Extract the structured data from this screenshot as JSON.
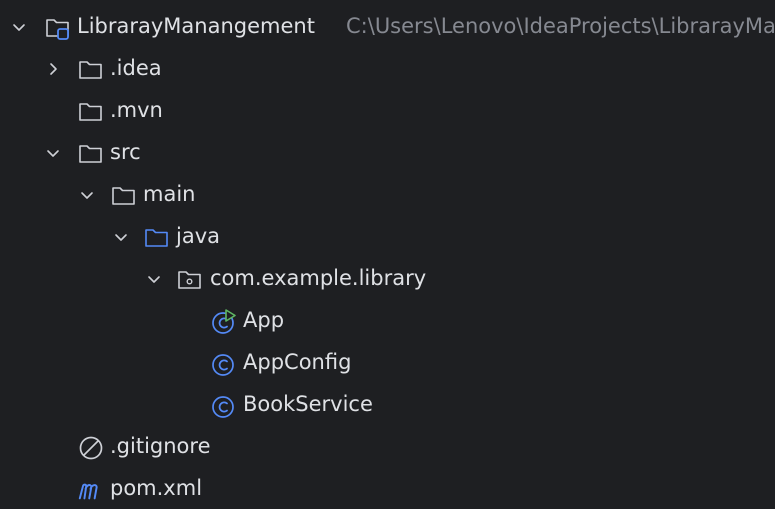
{
  "project": {
    "name": "LibrarayManangement",
    "path": "C:\\Users\\Lenovo\\IdeaProjects\\LibrarayManangement",
    "expanded": true,
    "icon": "project-folder-icon"
  },
  "tree": {
    "idea": {
      "label": ".idea",
      "expanded": false,
      "icon": "folder-icon"
    },
    "mvn": {
      "label": ".mvn",
      "icon": "folder-icon"
    },
    "src": {
      "label": "src",
      "expanded": true,
      "icon": "folder-icon"
    },
    "main": {
      "label": "main",
      "expanded": true,
      "icon": "folder-icon"
    },
    "java": {
      "label": "java",
      "expanded": true,
      "icon": "source-root-folder-icon"
    },
    "package": {
      "label": "com.example.library",
      "expanded": true,
      "icon": "package-icon"
    },
    "app": {
      "label": "App",
      "icon": "runnable-class-icon"
    },
    "appconfig": {
      "label": "AppConfig",
      "icon": "class-icon"
    },
    "bookservice": {
      "label": "BookService",
      "icon": "class-icon"
    },
    "gitignore": {
      "label": ".gitignore",
      "icon": "ignore-file-icon"
    },
    "pom": {
      "label": "pom.xml",
      "icon": "maven-icon"
    }
  },
  "colors": {
    "background": "#1e1f22",
    "text": "#dfe1e5",
    "muted_text": "#868991",
    "folder_outline": "#ced0d6",
    "source_folder": "#548af7",
    "class_icon": "#548af7",
    "run_badge": "#5fb865"
  }
}
